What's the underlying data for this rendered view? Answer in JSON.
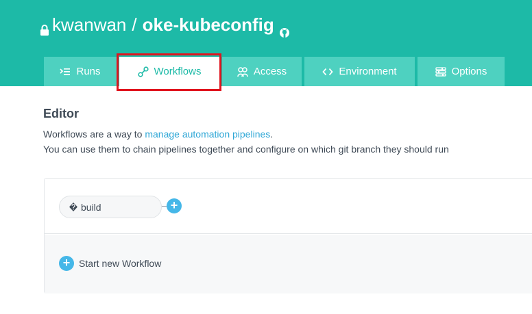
{
  "repo": {
    "owner": "kwanwan",
    "separator": "/",
    "name": "oke-kubeconfig",
    "lock_icon": "lock-icon",
    "host_icon": "github-icon"
  },
  "tabs": [
    {
      "label": "Runs",
      "icon": "runs-icon",
      "active": false
    },
    {
      "label": "Workflows",
      "icon": "workflows-icon",
      "active": true
    },
    {
      "label": "Access",
      "icon": "access-icon",
      "active": false
    },
    {
      "label": "Environment",
      "icon": "code-icon",
      "active": false
    },
    {
      "label": "Options",
      "icon": "options-icon",
      "active": false
    }
  ],
  "editor": {
    "title": "Editor",
    "desc_line1_prefix": "Workflows are a way to ",
    "desc_link": "manage automation pipelines",
    "desc_line1_suffix": ".",
    "desc_line2": "You can use them to chain pipelines together and configure on which git branch they should run"
  },
  "workflow": {
    "pipeline_glyph": "�",
    "pipeline_name": "build",
    "add_symbol": "+",
    "new_workflow_label": "Start new Workflow"
  },
  "colors": {
    "header": "#1dbaa7",
    "tab": "#4ed1c0",
    "link": "#2fa7d6",
    "add_button": "#45b7e8",
    "highlight": "#e0141e"
  }
}
